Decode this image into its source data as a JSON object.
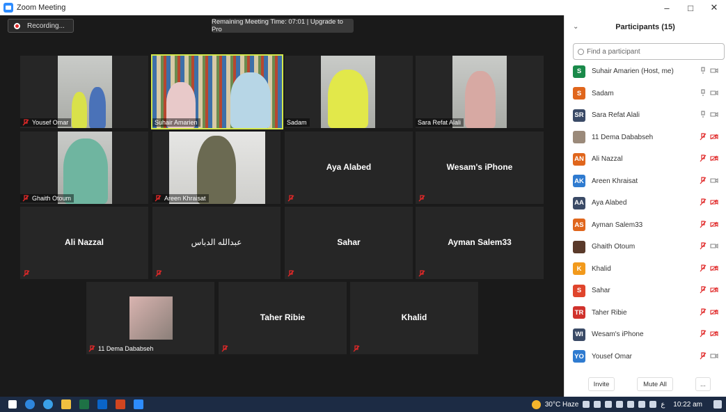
{
  "window": {
    "title": "Zoom Meeting",
    "minimize": "–",
    "maximize": "□",
    "close": "✕"
  },
  "toolbar": {
    "recording_label": "Recording...",
    "remaining_label": "Remaining Meeting Time: 07:01 | Upgrade to Pro"
  },
  "tiles": [
    {
      "name": "Yousef Omar"
    },
    {
      "name": "Suhair Amarien"
    },
    {
      "name": "Sadam"
    },
    {
      "name": "Sara Refat Alali"
    },
    {
      "name": "Ghaith Otoum"
    },
    {
      "name": "Areen Khraisat"
    },
    {
      "name": "Aya Alabed"
    },
    {
      "name": "Wesam's iPhone"
    },
    {
      "name": "Ali Nazzal"
    },
    {
      "name": "عبدالله الدباس"
    },
    {
      "name": "Sahar"
    },
    {
      "name": "Ayman Salem33"
    },
    {
      "name": "11 Dema Dababseh"
    },
    {
      "name": "Taher Ribie"
    },
    {
      "name": "Khalid"
    }
  ],
  "panel": {
    "title": "Participants (15)",
    "search_placeholder": "Find a participant",
    "invite_label": "Invite",
    "mute_all_label": "Mute All",
    "more_label": "...",
    "participants": [
      {
        "initials": "S",
        "name": "Suhair Amarien (Host, me)",
        "color": "#1a8a4a"
      },
      {
        "initials": "S",
        "name": "Sadam",
        "color": "#e0661c"
      },
      {
        "initials": "SR",
        "name": "Sara Refat Alali",
        "color": "#3a4a66"
      },
      {
        "initials": "",
        "name": "11 Dema Dababseh",
        "color": "#9b8a7a"
      },
      {
        "initials": "AN",
        "name": "Ali Nazzal",
        "color": "#e0661c"
      },
      {
        "initials": "AK",
        "name": "Areen Khraisat",
        "color": "#2f7bd0"
      },
      {
        "initials": "AA",
        "name": "Aya Alabed",
        "color": "#3a4a66"
      },
      {
        "initials": "AS",
        "name": "Ayman Salem33",
        "color": "#e0661c"
      },
      {
        "initials": "",
        "name": "Ghaith Otoum",
        "color": "#5a3a2a"
      },
      {
        "initials": "K",
        "name": "Khalid",
        "color": "#f29a1c"
      },
      {
        "initials": "S",
        "name": "Sahar",
        "color": "#e0452c"
      },
      {
        "initials": "TR",
        "name": "Taher Ribie",
        "color": "#d0322c"
      },
      {
        "initials": "WI",
        "name": "Wesam's iPhone",
        "color": "#3a4a66"
      },
      {
        "initials": "YO",
        "name": "Yousef Omar",
        "color": "#2f7bd0"
      }
    ]
  },
  "taskbar": {
    "weather": "30°C Haze",
    "lang": "ع",
    "time": "10:22 am"
  }
}
